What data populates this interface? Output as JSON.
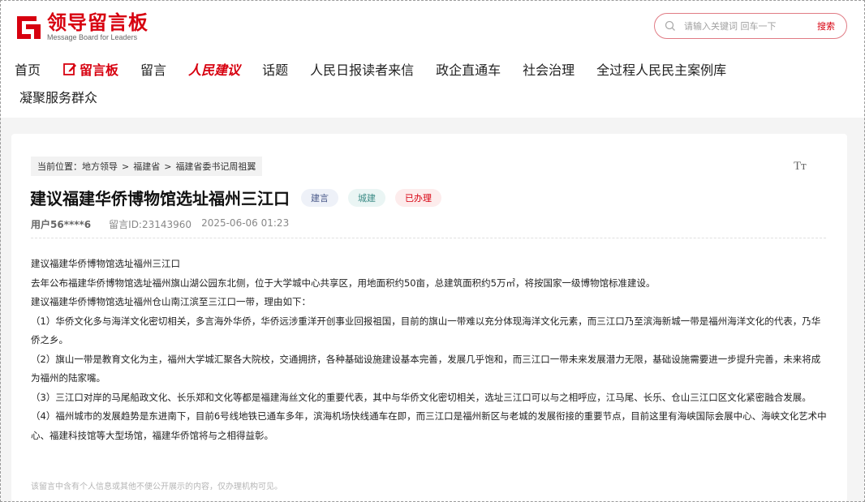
{
  "header": {
    "logo_title": "领导留言板",
    "logo_subtitle": "Message Board for Leaders",
    "brand_color": "#d7000f"
  },
  "search": {
    "placeholder": "请输入关键词 回车一下",
    "button_label": "搜索",
    "icon": "search-icon"
  },
  "nav": {
    "items": [
      {
        "label": "首页"
      },
      {
        "label": "留言板",
        "icon": "edit-icon",
        "active": true
      },
      {
        "label": "留言"
      },
      {
        "label": "人民建议"
      },
      {
        "label": "话题"
      },
      {
        "label": "人民日报读者来信"
      },
      {
        "label": "政企直通车"
      },
      {
        "label": "社会治理"
      },
      {
        "label": "全过程人民民主案例库"
      },
      {
        "label": "凝聚服务群众"
      }
    ]
  },
  "breadcrumb": {
    "prefix": "当前位置：",
    "items": [
      "地方领导",
      "福建省",
      "福建省委书记周祖翼"
    ],
    "separator": ">"
  },
  "font_size_toggle": "Tт",
  "message": {
    "title": "建议福建华侨博物馆选址福州三江口",
    "tags": [
      "建言",
      "城建",
      "已办理"
    ],
    "user": "用户56****6",
    "id_label": "留言ID:23143960",
    "timestamp": "2025-06-06 01:23",
    "paragraphs": [
      "建议福建华侨博物馆选址福州三江口",
      "去年公布福建华侨博物馆选址福州旗山湖公园东北侧，位于大学城中心共享区，用地面积约50亩，总建筑面积约5万㎡，将按国家一级博物馆标准建设。",
      "建议福建华侨博物馆选址福州仓山南江滨至三江口一带，理由如下：",
      "（1）华侨文化多与海洋文化密切相关，多言海外华侨，华侨远涉重洋开创事业回报祖国，目前的旗山一带难以充分体现海洋文化元素，而三江口乃至滨海新城一带是福州海洋文化的代表，乃华侨之乡。",
      "（2）旗山一带是教育文化为主，福州大学城汇聚各大院校，交通拥挤，各种基础设施建设基本完善，发展几乎饱和，而三江口一带未来发展潜力无限，基础设施需要进一步提升完善，未来将成为福州的陆家嘴。",
      "（3）三江口对岸的马尾船政文化、长乐郑和文化等都是福建海丝文化的重要代表，其中与华侨文化密切相关，选址三江口可以与之相呼应，江马尾、长乐、仓山三江口区文化紧密融合发展。",
      "（4）福州城市的发展趋势是东进南下，目前6号线地铁已通车多年，滨海机场快线通车在即，而三江口是福州新区与老城的发展衔接的重要节点，目前这里有海峡国际会展中心、海峡文化艺术中心、福建科技馆等大型场馆，福建华侨馆将与之相得益彰。"
    ],
    "privacy_notice": "该留言中含有个人信息或其他不便公开展示的内容，仅办理机构可见。"
  }
}
